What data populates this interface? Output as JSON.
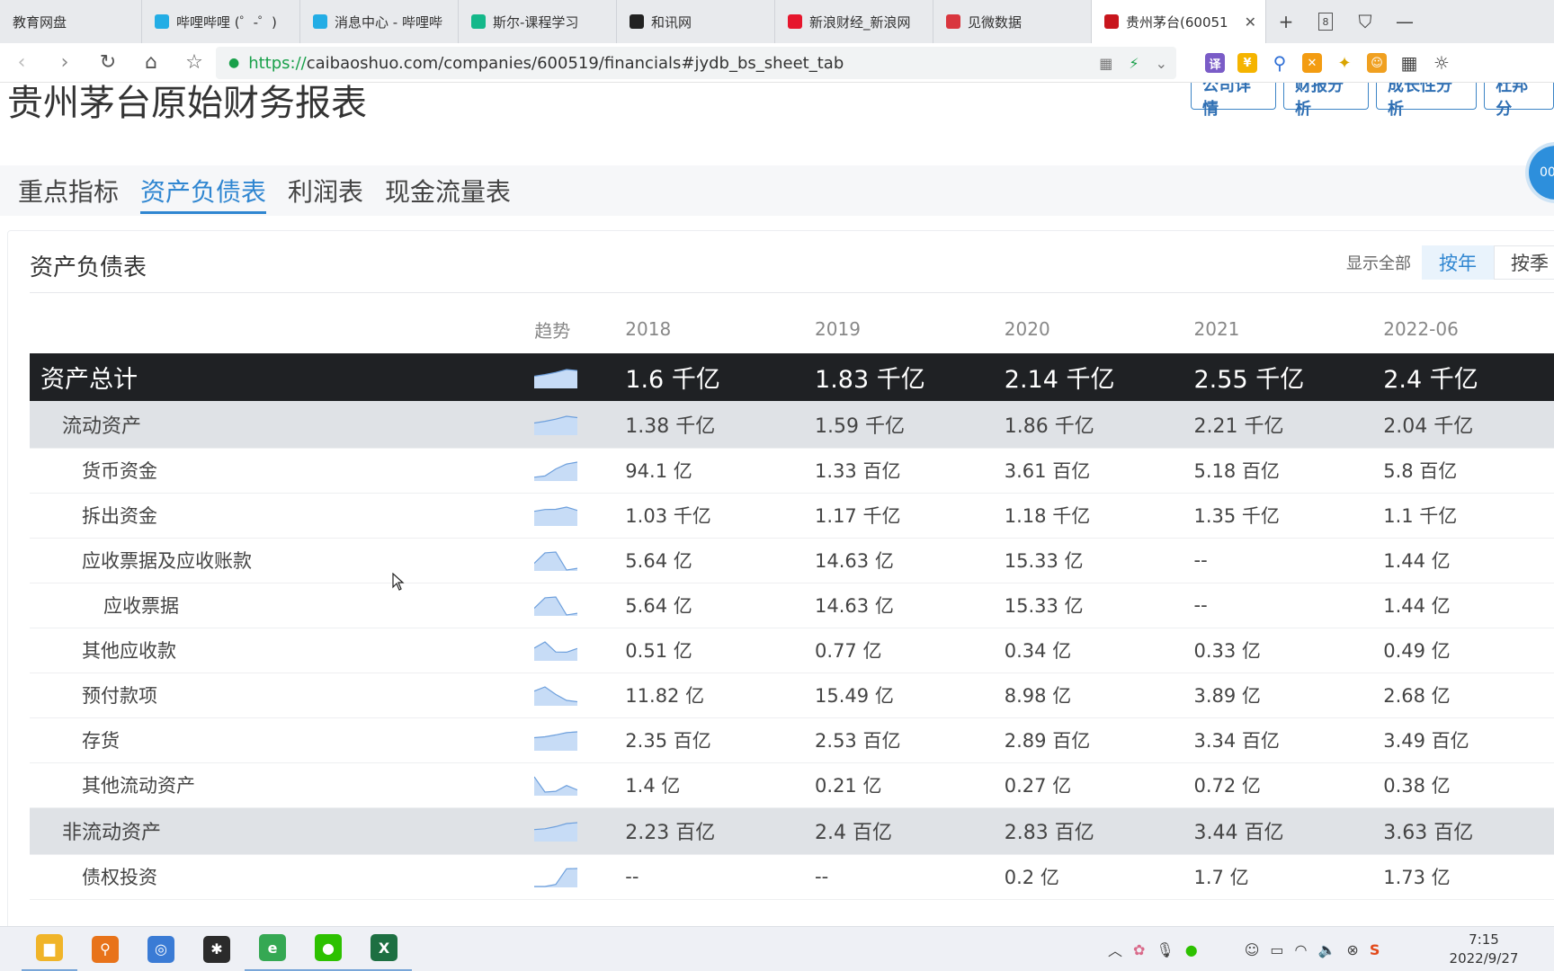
{
  "browser": {
    "tabs": [
      {
        "title": "教育网盘",
        "color": "#2f7fd6",
        "active": false
      },
      {
        "title": "哔哩哔哩 (゜-゜)",
        "color": "#23ade5",
        "active": false
      },
      {
        "title": "消息中心 - 哔哩哔",
        "color": "#23ade5",
        "active": false
      },
      {
        "title": "斯尔-课程学习",
        "color": "#14b88a",
        "active": false
      },
      {
        "title": "和讯网",
        "color": "#222222",
        "active": false
      },
      {
        "title": "新浪财经_新浪网",
        "color": "#e6162d",
        "active": false
      },
      {
        "title": "见微数据",
        "color": "#d9363e",
        "active": false
      },
      {
        "title": "贵州茅台(60051",
        "color": "#c8161d",
        "active": true
      }
    ],
    "tab_count": "8",
    "url_proto": "https://",
    "url_rest": "caibaoshuo.com/companies/600519/financials#jydb_bs_sheet_tab",
    "ext_translate": "译"
  },
  "page": {
    "title": "贵州茅台原始财务报表",
    "top_buttons": [
      "公司详情",
      "财报分析",
      "成长性分析",
      "杜邦分"
    ],
    "tabs": [
      {
        "label": "重点指标",
        "active": false
      },
      {
        "label": "资产负债表",
        "active": true
      },
      {
        "label": "利润表",
        "active": false
      },
      {
        "label": "现金流量表",
        "active": false
      }
    ],
    "timer": "00:",
    "card_title": "资产负债表",
    "show_all": "显示全部",
    "period_buttons": [
      {
        "label": "按年",
        "active": true
      },
      {
        "label": "按季",
        "active": false
      }
    ]
  },
  "table": {
    "trend_header": "趋势",
    "years": [
      "2018",
      "2019",
      "2020",
      "2021",
      "2022-06"
    ],
    "rows": [
      {
        "label": "资产总计",
        "type": "total",
        "level": 0,
        "values": [
          "1.6 千亿",
          "1.83 千亿",
          "2.14 千亿",
          "2.55 千亿",
          "2.4 千亿"
        ],
        "trend": [
          1.6,
          1.83,
          2.14,
          2.55,
          2.4
        ]
      },
      {
        "label": "流动资产",
        "type": "section",
        "level": 1,
        "values": [
          "1.38 千亿",
          "1.59 千亿",
          "1.86 千亿",
          "2.21 千亿",
          "2.04 千亿"
        ],
        "trend": [
          1.38,
          1.59,
          1.86,
          2.21,
          2.04
        ]
      },
      {
        "label": "货币资金",
        "type": "item",
        "level": 2,
        "values": [
          "94.1 亿",
          "1.33 百亿",
          "3.61 百亿",
          "5.18 百亿",
          "5.8 百亿"
        ],
        "trend": [
          94.1,
          133,
          361,
          518,
          580
        ]
      },
      {
        "label": "拆出资金",
        "type": "item",
        "level": 2,
        "values": [
          "1.03 千亿",
          "1.17 千亿",
          "1.18 千亿",
          "1.35 千亿",
          "1.1 千亿"
        ],
        "trend": [
          1.03,
          1.17,
          1.18,
          1.35,
          1.1
        ]
      },
      {
        "label": "应收票据及应收账款",
        "type": "item",
        "level": 2,
        "values": [
          "5.64 亿",
          "14.63 亿",
          "15.33 亿",
          "--",
          "1.44 亿"
        ],
        "trend": [
          5.64,
          14.63,
          15.33,
          0,
          1.44
        ]
      },
      {
        "label": "应收票据",
        "type": "item",
        "level": 3,
        "values": [
          "5.64 亿",
          "14.63 亿",
          "15.33 亿",
          "--",
          "1.44 亿"
        ],
        "trend": [
          5.64,
          14.63,
          15.33,
          0,
          1.44
        ]
      },
      {
        "label": "其他应收款",
        "type": "item",
        "level": 2,
        "values": [
          "0.51 亿",
          "0.77 亿",
          "0.34 亿",
          "0.33 亿",
          "0.49 亿"
        ],
        "trend": [
          0.51,
          0.77,
          0.34,
          0.33,
          0.49
        ]
      },
      {
        "label": "预付款项",
        "type": "item",
        "level": 2,
        "values": [
          "11.82 亿",
          "15.49 亿",
          "8.98 亿",
          "3.89 亿",
          "2.68 亿"
        ],
        "trend": [
          11.82,
          15.49,
          8.98,
          3.89,
          2.68
        ]
      },
      {
        "label": "存货",
        "type": "item",
        "level": 2,
        "values": [
          "2.35 百亿",
          "2.53 百亿",
          "2.89 百亿",
          "3.34 百亿",
          "3.49 百亿"
        ],
        "trend": [
          2.35,
          2.53,
          2.89,
          3.34,
          3.49
        ]
      },
      {
        "label": "其他流动资产",
        "type": "item",
        "level": 2,
        "values": [
          "1.4 亿",
          "0.21 亿",
          "0.27 亿",
          "0.72 亿",
          "0.38 亿"
        ],
        "trend": [
          1.4,
          0.21,
          0.27,
          0.72,
          0.38
        ]
      },
      {
        "label": "非流动资产",
        "type": "section",
        "level": 1,
        "values": [
          "2.23 百亿",
          "2.4 百亿",
          "2.83 百亿",
          "3.44 百亿",
          "3.63 百亿"
        ],
        "trend": [
          2.23,
          2.4,
          2.83,
          3.44,
          3.63
        ]
      },
      {
        "label": "债权投资",
        "type": "item",
        "level": 2,
        "values": [
          "--",
          "--",
          "0.2 亿",
          "1.7 亿",
          "1.73 亿"
        ],
        "trend": [
          0,
          0,
          0.2,
          1.7,
          1.73
        ]
      }
    ]
  },
  "taskbar": {
    "apps": [
      {
        "name": "file-explorer-icon",
        "color": "#f0b429",
        "glyph": "▆",
        "open": true
      },
      {
        "name": "search-app-icon",
        "color": "#e8731a",
        "glyph": "⚲",
        "open": false
      },
      {
        "name": "magnifier-app-icon",
        "color": "#3a7bd5",
        "glyph": "◎",
        "open": false
      },
      {
        "name": "tool-app-icon",
        "color": "#2b2b2b",
        "glyph": "✱",
        "open": false
      },
      {
        "name": "browser-app-icon",
        "color": "#35a853",
        "glyph": "e",
        "open": true
      },
      {
        "name": "wechat-app-icon",
        "color": "#2dc100",
        "glyph": "●",
        "open": true
      },
      {
        "name": "excel-app-icon",
        "color": "#1d6f42",
        "glyph": "X",
        "open": true
      }
    ],
    "time": "7:15",
    "date": "2022/9/27"
  }
}
